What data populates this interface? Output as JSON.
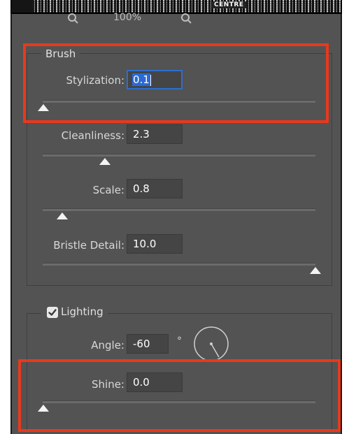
{
  "preview": {
    "caption": "CENTRE"
  },
  "zoom": {
    "level": "100%"
  },
  "brush": {
    "title": "Brush",
    "stylization": {
      "label": "Stylization:",
      "value": "0.1",
      "slider_fraction": 0.0
    },
    "cleanliness": {
      "label": "Cleanliness:",
      "value": "2.3",
      "slider_fraction": 0.23
    },
    "scale": {
      "label": "Scale:",
      "value": "0.8",
      "slider_fraction": 0.08
    },
    "bristle_detail": {
      "label": "Bristle Detail:",
      "value": "10.0",
      "slider_fraction": 1.0
    }
  },
  "lighting": {
    "title": "Lighting",
    "checked": true,
    "angle": {
      "label": "Angle:",
      "value": "-60",
      "unit": "°"
    },
    "shine": {
      "label": "Shine:",
      "value": "0.0",
      "slider_fraction": 0.0
    }
  },
  "colors": {
    "panel": "#535353",
    "highlight": "#e8391d",
    "focus": "#2d6fcf"
  }
}
